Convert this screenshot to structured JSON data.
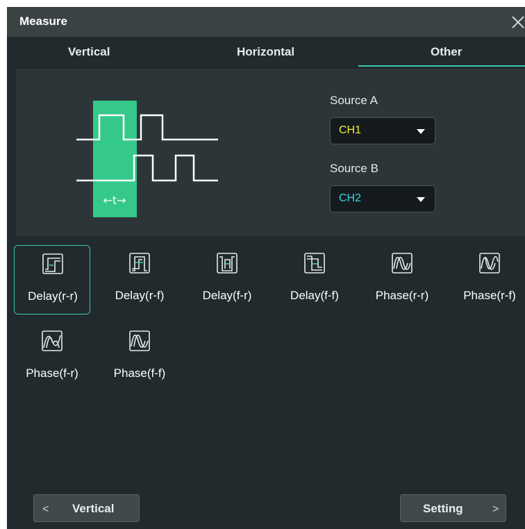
{
  "window": {
    "title": "Measure"
  },
  "tabs": [
    {
      "label": "Vertical",
      "active": false
    },
    {
      "label": "Horizontal",
      "active": false
    },
    {
      "label": "Other",
      "active": true
    }
  ],
  "diagram": {
    "t_label": "←t→"
  },
  "sources": {
    "a": {
      "label": "Source A",
      "value": "CH1",
      "color": "#f0ec3a"
    },
    "b": {
      "label": "Source B",
      "value": "CH2",
      "color": "#39d6f0"
    }
  },
  "items": [
    {
      "label": "Delay(r-r)",
      "icon": "delay-rr-icon",
      "selected": true
    },
    {
      "label": "Delay(r-f)",
      "icon": "delay-rf-icon"
    },
    {
      "label": "Delay(f-r)",
      "icon": "delay-fr-icon"
    },
    {
      "label": "Delay(f-f)",
      "icon": "delay-ff-icon"
    },
    {
      "label": "Phase(r-r)",
      "icon": "phase-rr-icon"
    },
    {
      "label": "Phase(r-f)",
      "icon": "phase-rf-icon"
    },
    {
      "label": "Phase(f-r)",
      "icon": "phase-fr-icon"
    },
    {
      "label": "Phase(f-f)",
      "icon": "phase-ff-icon"
    }
  ],
  "footer": {
    "prev_label": "Vertical",
    "next_label": "Setting",
    "prev_chevron": "<",
    "next_chevron": ">"
  },
  "colors": {
    "accent": "#3ec9b1",
    "highlight": "#34c98a"
  }
}
